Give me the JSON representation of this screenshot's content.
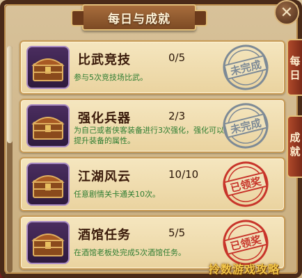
{
  "window": {
    "title": "每日与成就",
    "close_label": "✕"
  },
  "side_tabs": [
    "每日",
    "成就"
  ],
  "tasks": [
    {
      "name": "比武竞技",
      "progress": "0/5",
      "desc": "参与5次竞技场比武。",
      "stamp": "未完成",
      "status": "incomplete"
    },
    {
      "name": "强化兵器",
      "progress": "2/3",
      "desc": "为自己或者侠客装备进行3次强化，强化可以提升装备的属性。",
      "stamp": "未完成",
      "status": "incomplete"
    },
    {
      "name": "江湖风云",
      "progress": "10/10",
      "desc": "任意剧情关卡通关10次。",
      "stamp": "已领奖",
      "status": "claimed"
    },
    {
      "name": "酒馆任务",
      "progress": "5/5",
      "desc": "在酒馆老板处完成5次酒馆任务。",
      "stamp": "已领奖",
      "status": "claimed"
    }
  ],
  "watermark": "拎数游戏攻略",
  "colors": {
    "incomplete_stamp": "#7d8a96",
    "claimed_stamp": "#c8342a",
    "desc_text": "#2e7d32"
  }
}
